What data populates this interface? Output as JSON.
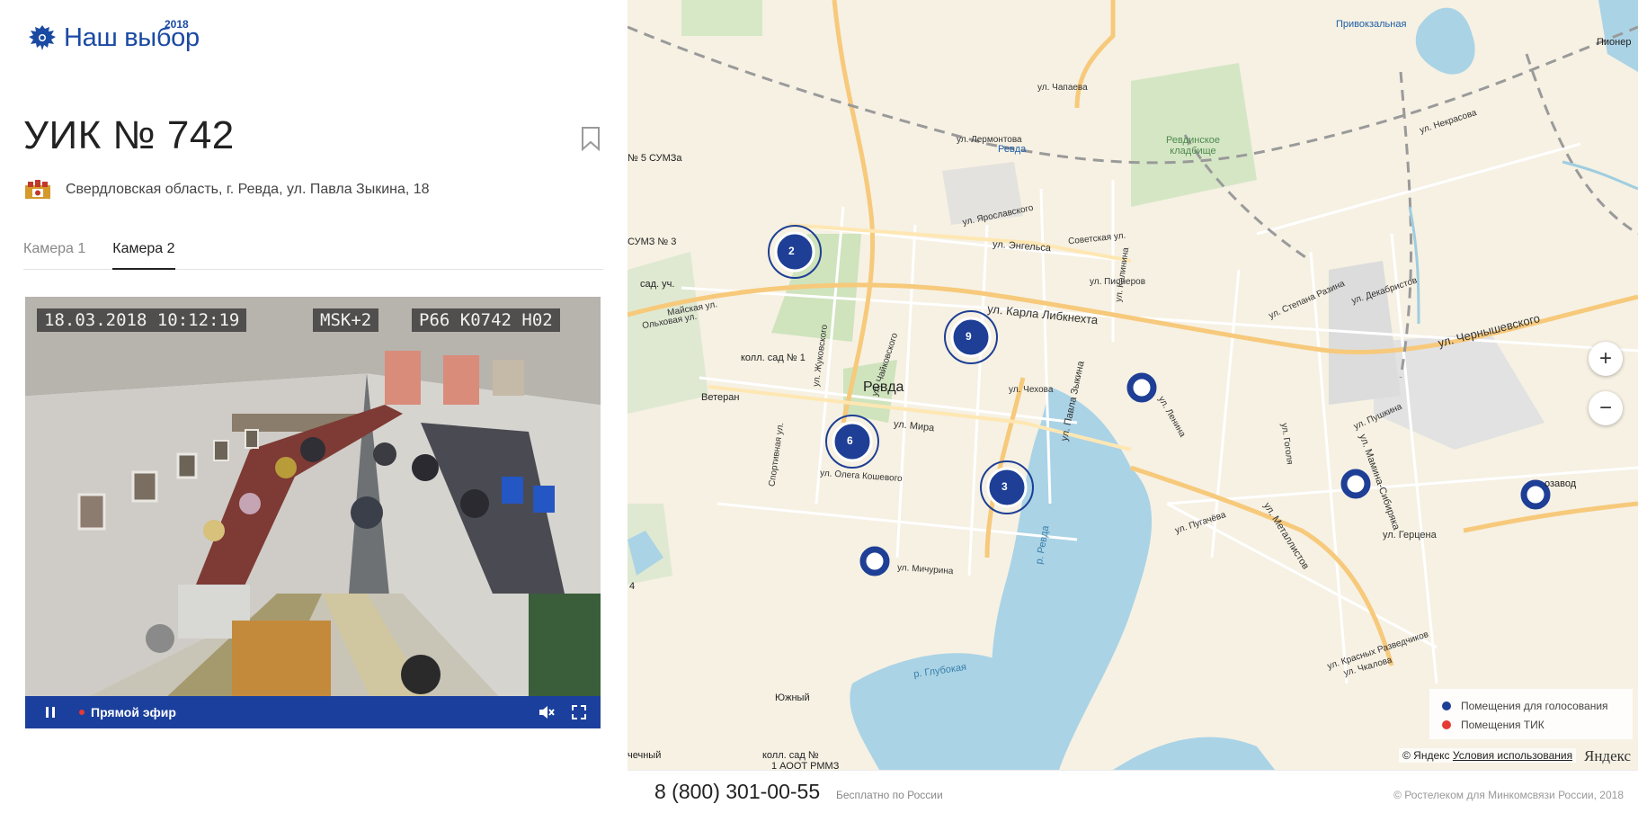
{
  "logo": {
    "text": "Наш выбор",
    "year": "2018"
  },
  "uik": {
    "title": "УИК № 742",
    "address": "Свердловская область, г. Ревда, ул. Павла Зыкина, 18"
  },
  "tabs": [
    {
      "label": "Камера 1",
      "active": false
    },
    {
      "label": "Камера 2",
      "active": true
    }
  ],
  "video": {
    "osd_datetime": "18.03.2018 10:12:19",
    "osd_zone": "MSK+2",
    "osd_id": "Р66 К0742 Н02",
    "live_label": "Прямой эфир",
    "pause_icon": "pause-icon",
    "mute_icon": "volume-muted-icon",
    "fullscreen_icon": "fullscreen-icon"
  },
  "map": {
    "zoom_in": "+",
    "zoom_out": "−",
    "clusters": [
      "2",
      "9",
      "6",
      "3"
    ],
    "labels": {
      "city": "Ревда",
      "karla": "ул. Карла Либкнехта",
      "chernysh": "ул. Чернышевского",
      "mira": "ул. Мира",
      "engelsa": "ул. Энгельса",
      "zykina": "ул. Павла Зыкина",
      "metall": "ул. Металлистов",
      "gertsena": "ул. Герцена",
      "kladb": "Ревдинское кладбище",
      "privokz": "Привокзальная",
      "revda_st": "Ревда",
      "veteran": "Ветеран",
      "sad1": "колл. сад № 1",
      "sad_uch": "сад. уч.",
      "yuzh": "Южный",
      "glub": "р. Глубокая",
      "r_revda": "р. Ревда",
      "sums3": "СУМЗ № 3",
      "sums5": "№ 5 СУМЗа",
      "pioner": "Пионер",
      "kosh": "ул. Олега Кошевого",
      "michur": "ул. Мичурина",
      "lermont": "ул. Лермонтова",
      "chapaeva": "ул. Чапаева",
      "yaroslav": "ул. Ярославского",
      "pionerov": "ул. Пионеров",
      "chekhova": "ул. Чехова",
      "nekras": "ул. Некрасова",
      "lenina": "ул. Ленина",
      "zhukov": "ул. Жуковского",
      "sport": "Спортивная ул.",
      "chaik": "ул. Чайковского",
      "pugach": "ул. Пугачёва",
      "gogolya": "ул. Гоголя",
      "pushkina": "ул. Пушкина",
      "dekabr": "ул. Декабристов",
      "razina": "ул. Степана Разина",
      "sibiryaka": "ул. Мамина-Сибиряка",
      "chkalova": "ул. Чкалова",
      "krasnyh": "ул. Красных Разведчиков",
      "sad_n": "колл. сад №",
      "aoot": "1 АООТ РММЗ",
      "chnechny": "чечный",
      "zavod": "озавод",
      "four": "4",
      "sovet": "Советская ул.",
      "kalinina": "ул. Калинина",
      "maisk": "Майская ул.",
      "olh": "Ольховая ул."
    },
    "legend": [
      {
        "label": "Помещения для голосования",
        "color": "#1e3f95"
      },
      {
        "label": "Помещения ТИК",
        "color": "#e53935"
      }
    ],
    "attribution": {
      "copyright": "© Яндекс",
      "terms": "Условия использования",
      "brand": "Яндекс"
    }
  },
  "footer": {
    "phone": "8 (800) 301-00-55",
    "phone_note": "Бесплатно по России",
    "copyright": "© Ростелеком для Минкомсвязи России, 2018"
  }
}
